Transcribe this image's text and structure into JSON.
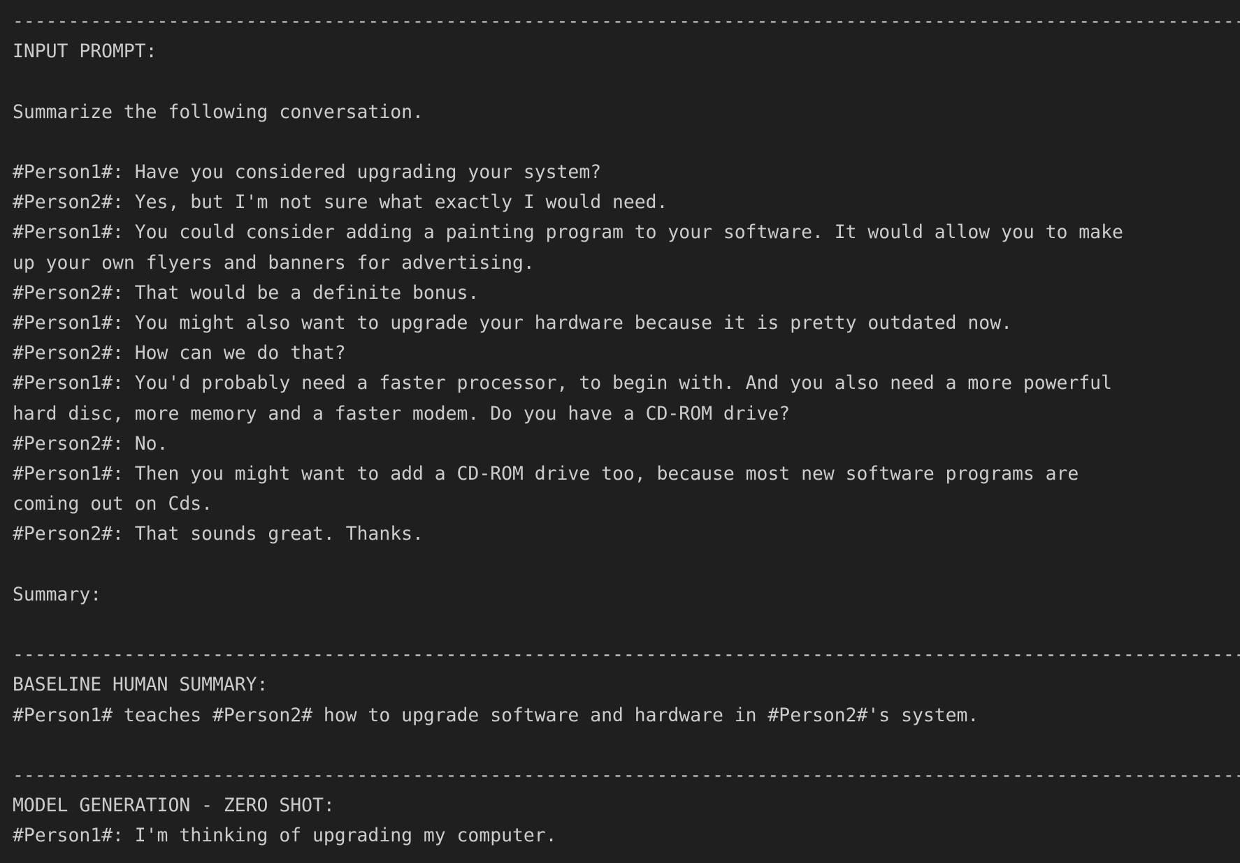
{
  "output": {
    "separator": "------------------------------------------------------------------------------------------------------------------",
    "input_prompt": {
      "header": "INPUT PROMPT:",
      "instruction": "Summarize the following conversation.",
      "dialogue": [
        "#Person1#: Have you considered upgrading your system?",
        "#Person2#: Yes, but I'm not sure what exactly I would need.",
        "#Person1#: You could consider adding a painting program to your software. It would allow you to make",
        "up your own flyers and banners for advertising.",
        "#Person2#: That would be a definite bonus.",
        "#Person1#: You might also want to upgrade your hardware because it is pretty outdated now.",
        "#Person2#: How can we do that?",
        "#Person1#: You'd probably need a faster processor, to begin with. And you also need a more powerful",
        "hard disc, more memory and a faster modem. Do you have a CD-ROM drive?",
        "#Person2#: No.",
        "#Person1#: Then you might want to add a CD-ROM drive too, because most new software programs are",
        "coming out on Cds.",
        "#Person2#: That sounds great. Thanks."
      ],
      "summary_label": "Summary:"
    },
    "baseline": {
      "header": "BASELINE HUMAN SUMMARY:",
      "text": "#Person1# teaches #Person2# how to upgrade software and hardware in #Person2#'s system."
    },
    "model_generation": {
      "header": "MODEL GENERATION - ZERO SHOT:",
      "text": "#Person1#: I'm thinking of upgrading my computer."
    }
  }
}
